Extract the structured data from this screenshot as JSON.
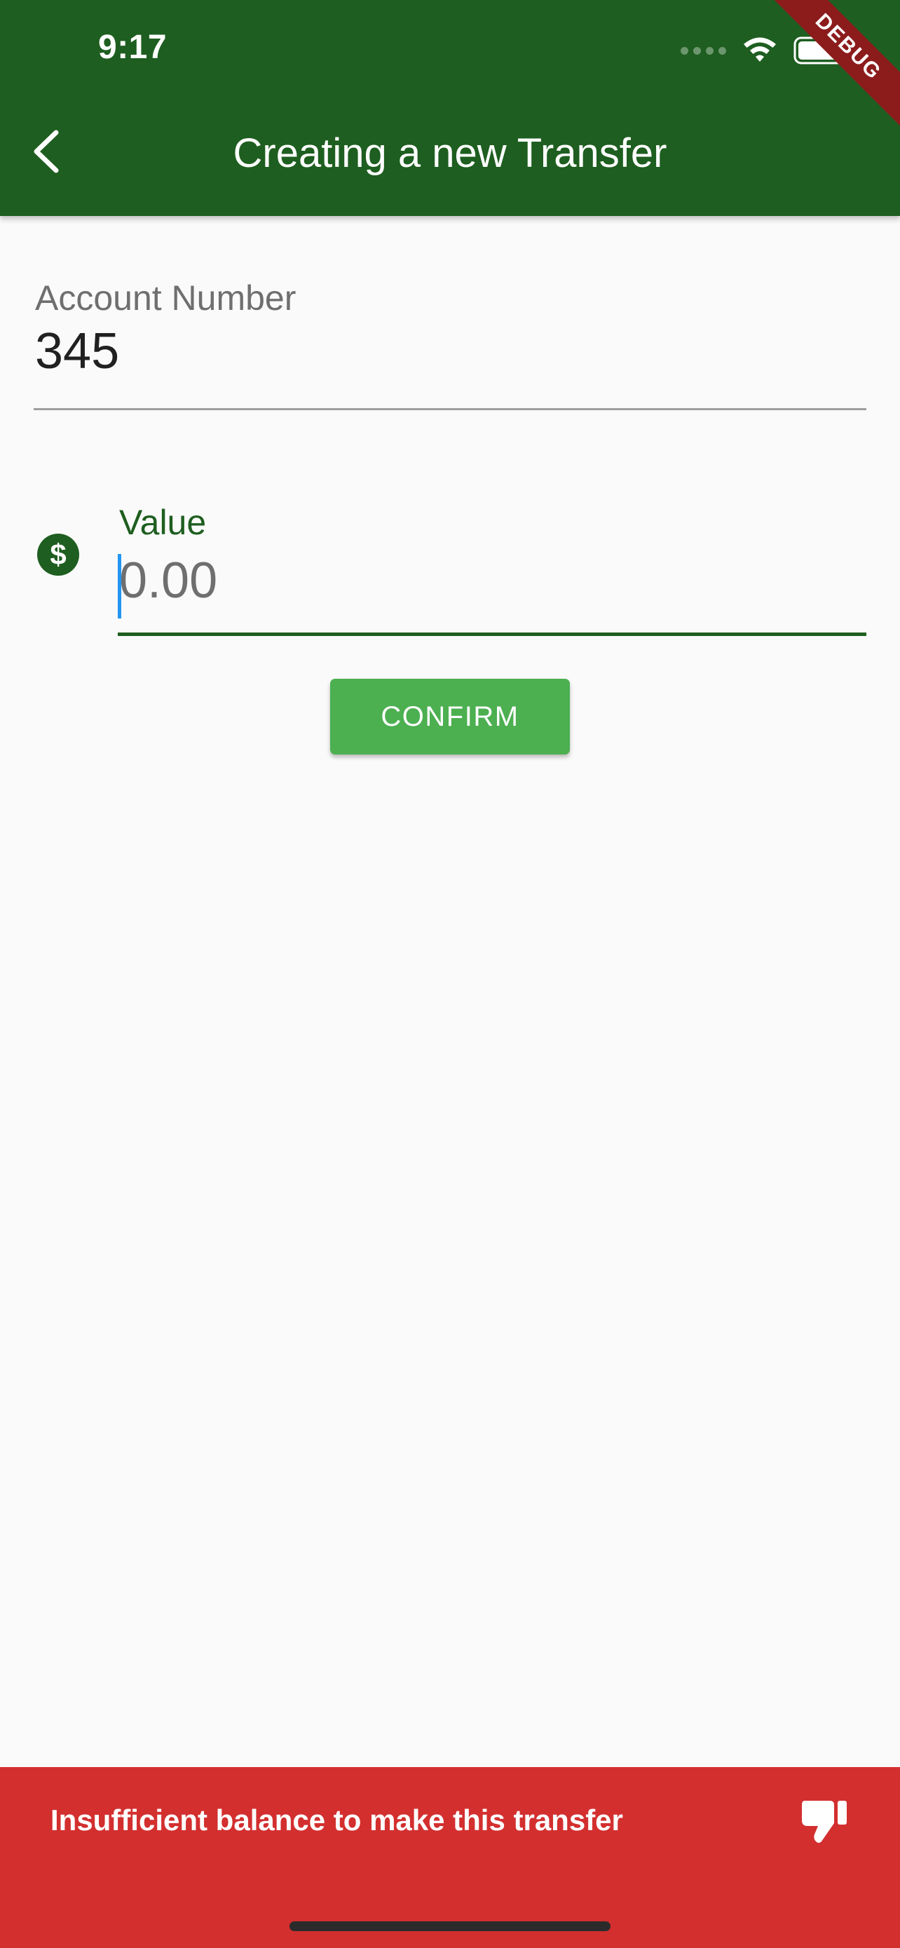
{
  "status_bar": {
    "time": "9:17"
  },
  "debug_banner": "DEBUG",
  "app_bar": {
    "title": "Creating a new Transfer",
    "back_icon": "chevron-left-icon"
  },
  "form": {
    "account_number": {
      "label": "Account Number",
      "value": "345"
    },
    "value_field": {
      "label": "Value",
      "placeholder": "0.00",
      "value": "",
      "icon": "dollar-circle-icon"
    },
    "confirm_label": "CONFIRM"
  },
  "snackbar": {
    "message": "Insufficient balance to make this transfer",
    "icon": "thumb-down-icon"
  },
  "colors": {
    "primary": "#1e5e20",
    "button": "#4caf50",
    "error": "#d32f2f",
    "caret": "#2196f3"
  }
}
